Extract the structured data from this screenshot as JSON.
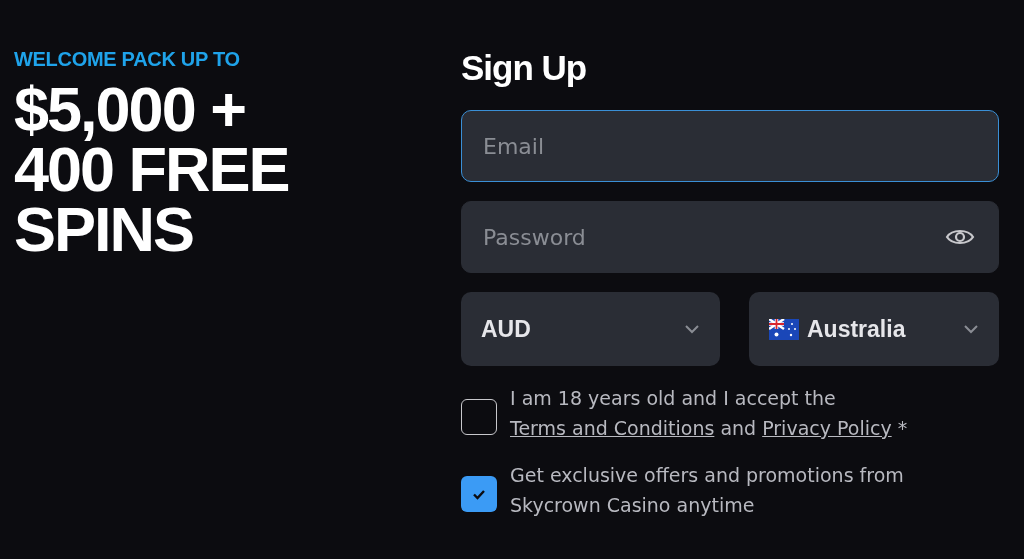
{
  "promo": {
    "eyebrow": "WELCOME PACK UP TO",
    "headline": [
      "$5,000 +",
      "400 FREE",
      "SPINS"
    ]
  },
  "form": {
    "title": "Sign Up",
    "email": {
      "placeholder": "Email",
      "focused": true
    },
    "password": {
      "placeholder": "Password"
    },
    "currency": {
      "value": "AUD"
    },
    "country": {
      "value": "Australia"
    },
    "consents": [
      {
        "checked": false,
        "parts": [
          {
            "kind": "text",
            "text": "I am 18 years old and I accept the "
          },
          {
            "kind": "link",
            "text": "Terms and Conditions"
          },
          {
            "kind": "text",
            "text": " and "
          },
          {
            "kind": "link",
            "text": "Privacy Policy"
          },
          {
            "kind": "text",
            "text": " *"
          }
        ]
      },
      {
        "checked": true,
        "parts": [
          {
            "kind": "text",
            "text": "Get exclusive offers and promotions from Skycrown Casino anytime"
          }
        ]
      }
    ]
  }
}
